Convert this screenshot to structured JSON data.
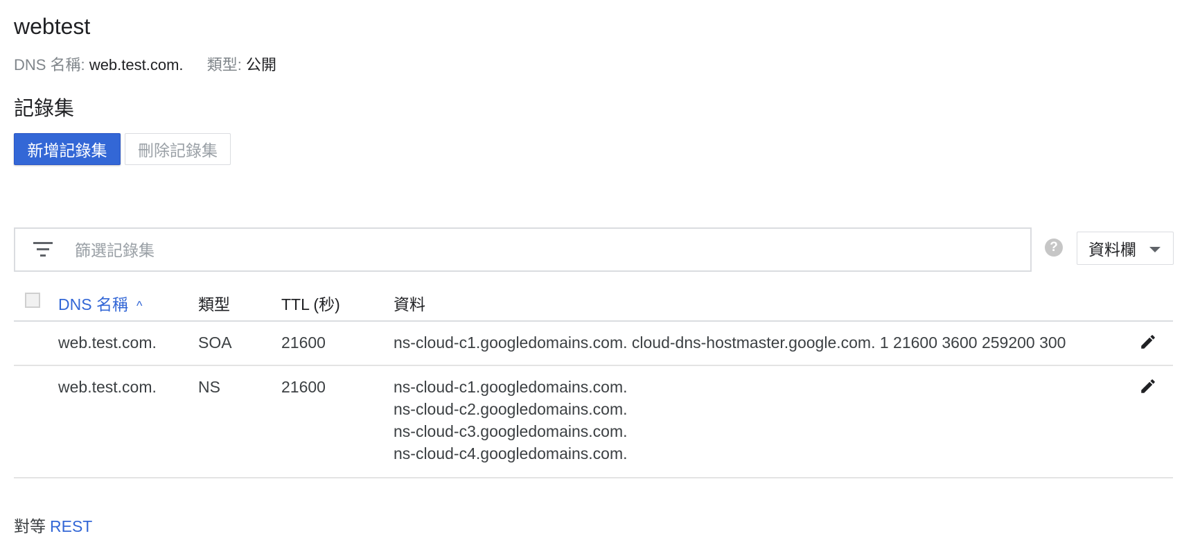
{
  "zone": {
    "title": "webtest",
    "dns_name_label": "DNS 名稱:",
    "dns_name_value": "web.test.com.",
    "type_label": "類型:",
    "type_value": "公開"
  },
  "record_sets": {
    "section_title": "記錄集",
    "add_button": "新增記錄集",
    "delete_button": "刪除記錄集",
    "filter_placeholder": "篩選記錄集",
    "help_icon_text": "?",
    "columns_button": "資料欄"
  },
  "table": {
    "headers": {
      "dns_name": "DNS 名稱",
      "sort_indicator": "^",
      "type": "類型",
      "ttl": "TTL (秒)",
      "data": "資料"
    },
    "rows": [
      {
        "name": "web.test.com.",
        "type": "SOA",
        "ttl": "21600",
        "data": [
          "ns-cloud-c1.googledomains.com. cloud-dns-hostmaster.google.com. 1 21600 3600 259200 300"
        ]
      },
      {
        "name": "web.test.com.",
        "type": "NS",
        "ttl": "21600",
        "data": [
          "ns-cloud-c1.googledomains.com.",
          "ns-cloud-c2.googledomains.com.",
          "ns-cloud-c3.googledomains.com.",
          "ns-cloud-c4.googledomains.com."
        ]
      }
    ]
  },
  "footer": {
    "equivalent_label": "對等",
    "rest_link": "REST"
  },
  "colors": {
    "primary": "#3367d6",
    "muted_text": "#80868b",
    "border": "#dadce0"
  }
}
